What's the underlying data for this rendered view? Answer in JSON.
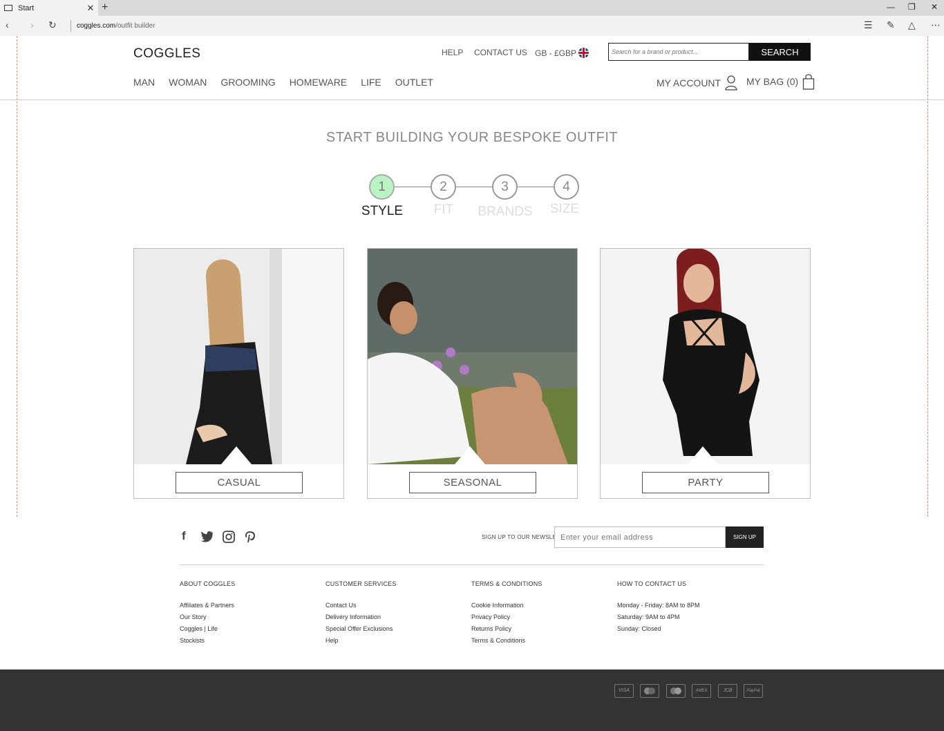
{
  "browser": {
    "tab_title": "Start",
    "tab_close": "✕",
    "new_tab": "+",
    "url_domain": "coggles.com",
    "url_path": "/outfit builder",
    "win_minimize": "—",
    "win_restore": "❐",
    "win_close": "✕"
  },
  "header": {
    "logo": "COGGLES",
    "help": "HELP",
    "contact": "CONTACT US",
    "currency": "GB - £GBP",
    "search_placeholder": "Search for a brand or product...",
    "search_button": "SEARCH",
    "nav": [
      "MAN",
      "WOMAN",
      "GROOMING",
      "HOMEWARE",
      "LIFE",
      "OUTLET"
    ],
    "account": "MY ACCOUNT",
    "bag": "MY BAG (0)"
  },
  "builder": {
    "headline": "START BUILDING YOUR BESPOKE OUTFIT",
    "steps": [
      {
        "num": "1",
        "label": "STYLE"
      },
      {
        "num": "2",
        "label": "FIT"
      },
      {
        "num": "3",
        "label": "BRANDS"
      },
      {
        "num": "4",
        "label": "SIZE"
      }
    ],
    "active_step": 1,
    "cards": [
      "CASUAL",
      "SEASONAL",
      "PARTY"
    ]
  },
  "footer": {
    "newsletter_label": "SIGN UP TO OUR NEWSLETTER",
    "email_placeholder": "Enter your email address",
    "signup_button": "SIGN UP",
    "social": [
      "facebook-icon",
      "twitter-icon",
      "instagram-icon",
      "pinterest-icon"
    ],
    "columns": [
      {
        "title": "ABOUT COGGLES",
        "links": [
          "Affiliates & Partners",
          "Our Story",
          "Coggles | Life",
          "Stockists"
        ]
      },
      {
        "title": "CUSTOMER SERVICES",
        "links": [
          "Contact Us",
          "Delivery Information",
          "Special Offer Exclusions",
          "Help"
        ]
      },
      {
        "title": "TERMS & CONDITIONS",
        "links": [
          "Cookie Information",
          "Privacy Policy",
          "Returns Policy",
          "Terms & Conditions"
        ]
      },
      {
        "title": "HOW TO CONTACT US",
        "links": [
          "Monday - Friday: 8AM to 8PM",
          "Saturday: 9AM to 4PM",
          "Sunday: Closed"
        ]
      }
    ],
    "payments": [
      "VISA",
      "Mastercard",
      "Maestro",
      "AMEX",
      "JCB",
      "PayPal"
    ]
  },
  "colors": {
    "active_step": "#b9f5c4",
    "bottom_bar": "#333333",
    "accent": "#111111"
  }
}
